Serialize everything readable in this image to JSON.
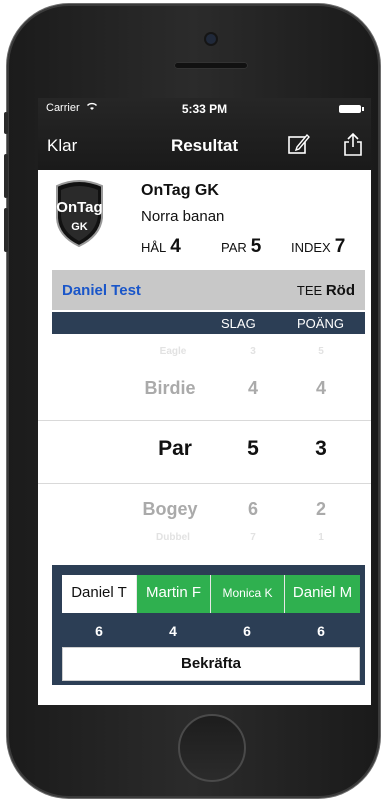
{
  "status_bar": {
    "carrier": "Carrier",
    "time": "5:33 PM"
  },
  "nav": {
    "back_label": "Klar",
    "title": "Resultat",
    "edit_icon": "edit-icon",
    "share_icon": "share-icon"
  },
  "header": {
    "logo_text_top": "OnTag",
    "logo_text_bottom": "GK",
    "club": "OnTag GK",
    "course": "Norra banan",
    "hole_label": "HÅL",
    "hole_value": "4",
    "par_label": "PAR",
    "par_value": "5",
    "index_label": "INDEX",
    "index_value": "7"
  },
  "player": {
    "name": "Daniel Test",
    "tee_label": "TEE",
    "tee_value": "Röd"
  },
  "columns": {
    "slag": "SLAG",
    "poang": "POÄNG"
  },
  "picker_rows": [
    {
      "label": "Eagle",
      "slag": "3",
      "poang": "5"
    },
    {
      "label": "Birdie",
      "slag": "4",
      "poang": "4"
    },
    {
      "label": "Par",
      "slag": "5",
      "poang": "3"
    },
    {
      "label": "Bogey",
      "slag": "6",
      "poang": "2"
    },
    {
      "label": "Dubbel",
      "slag": "7",
      "poang": "1"
    }
  ],
  "players": [
    {
      "name": "Daniel T",
      "strokes": "6",
      "state": "active"
    },
    {
      "name": "Martin F",
      "strokes": "4",
      "state": "done"
    },
    {
      "name": "Monica K",
      "strokes": "6",
      "state": "done"
    },
    {
      "name": "Daniel M",
      "strokes": "6",
      "state": "done"
    }
  ],
  "confirm_label": "Bekräfta",
  "colors": {
    "accent_blue": "#1a56c9",
    "done_green": "#2fb04f",
    "panel_navy": "#2c3e55"
  }
}
